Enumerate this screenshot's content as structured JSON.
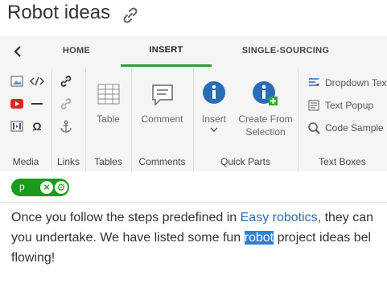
{
  "title": "Robot ideas",
  "tabs": [
    {
      "label": "HOME"
    },
    {
      "label": "INSERT",
      "active": true
    },
    {
      "label": "SINGLE-SOURCING"
    }
  ],
  "groups": {
    "media": {
      "label": "Media"
    },
    "links": {
      "label": "Links"
    },
    "tables": {
      "label": "Tables",
      "table_button": "Table"
    },
    "comments": {
      "label": "Comments",
      "comment_button": "Comment"
    },
    "quick_parts": {
      "label": "Quick Parts",
      "insert_button": "Insert",
      "create_button": "Create From Selection"
    },
    "text_boxes": {
      "label": "Text Boxes",
      "items": [
        "Dropdown Text",
        "Text Popup",
        "Code Sample"
      ]
    }
  },
  "tag": {
    "name": "p"
  },
  "content": {
    "line1_before": "Once you follow the steps predefined in ",
    "line1_link": "Easy robotics",
    "line1_after": ", they can",
    "line2_before": "you undertake. We have listed some fun ",
    "line2_highlight": "robot",
    "line2_after": " project ideas bel",
    "line3": "flowing!"
  },
  "colors": {
    "accent_green": "#2e9e2e",
    "tag_green": "#1a9c1a",
    "info_blue": "#2a6db5",
    "highlight": "#2f7fd6"
  }
}
